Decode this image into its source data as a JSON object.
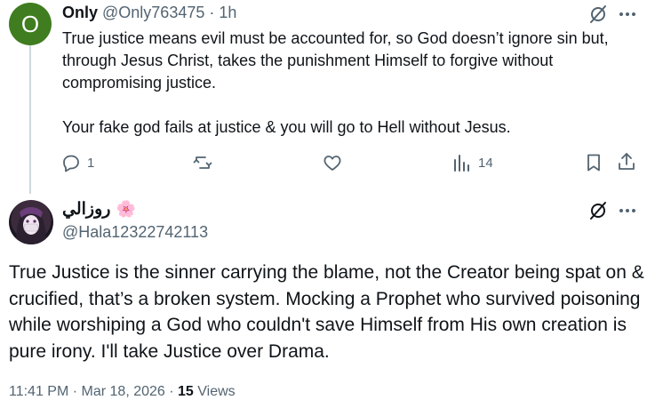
{
  "tweet1": {
    "avatar_letter": "O",
    "display_name": "Only",
    "handle": "@Only763475",
    "separator": "·",
    "time": "1h",
    "paragraphs": [
      "True justice means evil must be accounted for, so God doesn’t ignore sin but, through Jesus Christ, takes the punishment Himself to forgive without compromising justice.",
      "Your fake god fails at justice & you will go to Hell without Jesus."
    ],
    "actions": {
      "reply_count": "1",
      "retweet_count": "",
      "like_count": "",
      "views_count": "14"
    }
  },
  "tweet2": {
    "display_name": "روزالي",
    "emoji": "🌸",
    "handle": "@Hala12322742113",
    "body": "True Justice is the sinner carrying the blame, not the Creator being spat on & crucified, that’s a broken system. Mocking a Prophet who survived poisoning while worshiping a God who couldn't save Himself from His own creation is pure irony. I'll take Justice over Drama.",
    "footer_time": "11:41 PM · Mar 18, 2026 ·",
    "footer_views_count": "15",
    "footer_views_label": "Views"
  },
  "icons": [
    "grok-icon",
    "more-icon",
    "reply-icon",
    "retweet-icon",
    "like-icon",
    "views-icon",
    "bookmark-icon",
    "share-icon"
  ],
  "colors": {
    "text": "#0f1419",
    "muted": "#536471",
    "avatar1": "#3f7d20",
    "thread_line": "#cfd9de"
  }
}
